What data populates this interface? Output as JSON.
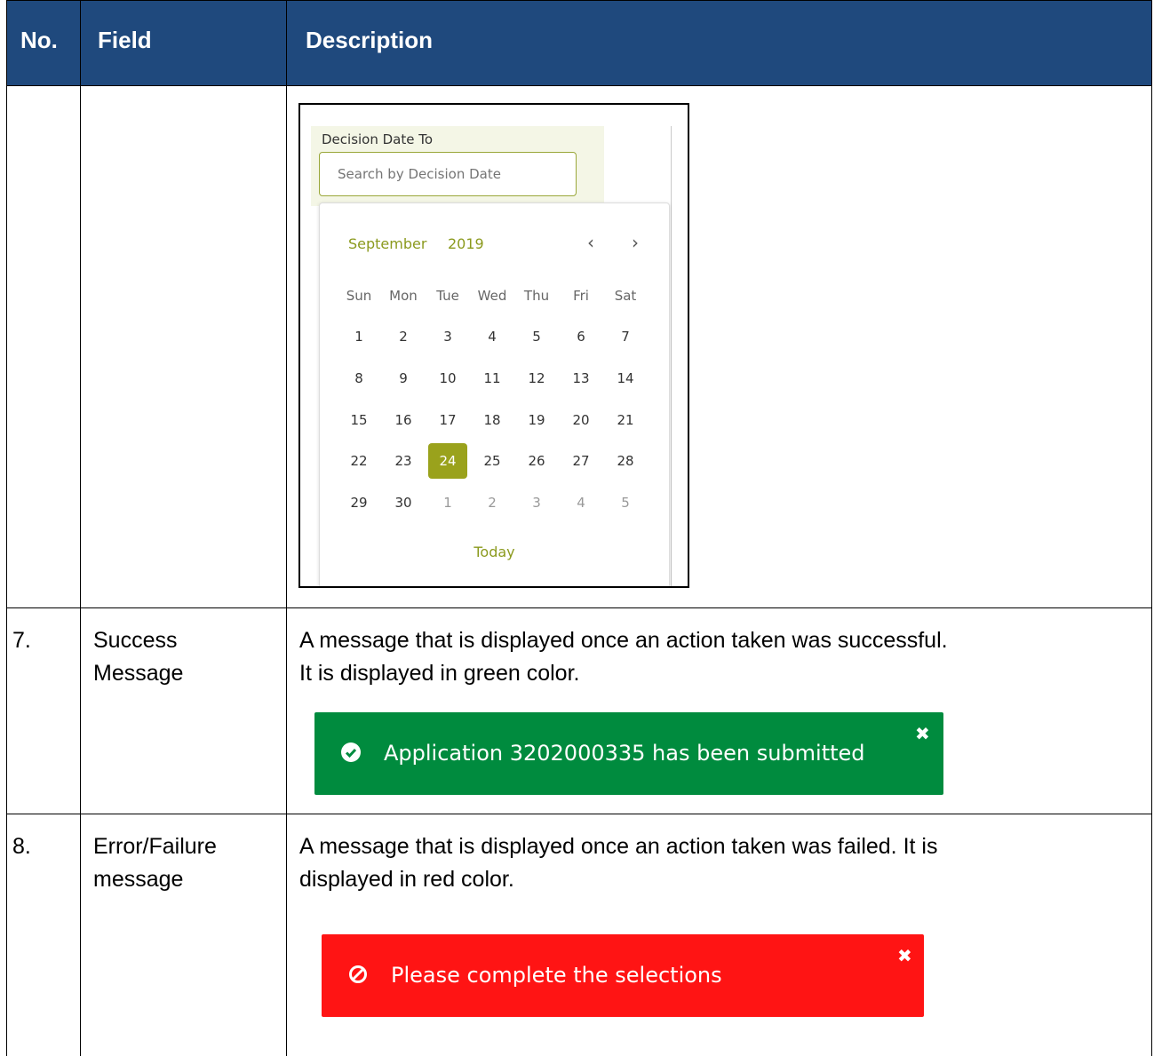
{
  "header": {
    "no": "No.",
    "field": "Field",
    "description": "Description"
  },
  "datepicker": {
    "label": "Decision Date To",
    "placeholder": "Search by Decision Date",
    "month": "September",
    "year": "2019",
    "prev": "‹",
    "next": "›",
    "weekdays": [
      "Sun",
      "Mon",
      "Tue",
      "Wed",
      "Thu",
      "Fri",
      "Sat"
    ],
    "weeks": [
      [
        "1",
        "2",
        "3",
        "4",
        "5",
        "6",
        "7"
      ],
      [
        "8",
        "9",
        "10",
        "11",
        "12",
        "13",
        "14"
      ],
      [
        "15",
        "16",
        "17",
        "18",
        "19",
        "20",
        "21"
      ],
      [
        "22",
        "23",
        "24",
        "25",
        "26",
        "27",
        "28"
      ],
      [
        "29",
        "30",
        "1",
        "2",
        "3",
        "4",
        "5"
      ]
    ],
    "selected_day": "24",
    "today_label": "Today"
  },
  "rows": [
    {
      "no": "7.",
      "field_line1": "Success",
      "field_line2": "Message",
      "desc_line1": "A message that is displayed once an action taken was successful.",
      "desc_line2": "It is displayed in green color.",
      "alert_text": "Application 3202000335 has been submitted",
      "alert_color": "#008b3e",
      "icon": "check-circle-icon"
    },
    {
      "no": "8.",
      "field_line1": "Error/Failure",
      "field_line2": "message",
      "desc_line1": "A message that is displayed once an action taken was failed. It is",
      "desc_line2": "displayed in red color.",
      "alert_text": "Please complete the selections",
      "alert_color": "#ff1414",
      "icon": "ban-icon"
    }
  ],
  "close_glyph": "✖"
}
